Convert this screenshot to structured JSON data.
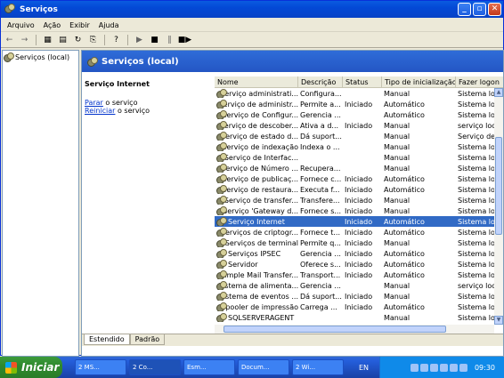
{
  "window": {
    "title": "Serviços"
  },
  "menu": [
    "Arquivo",
    "Ação",
    "Exibir",
    "Ajuda"
  ],
  "tree": {
    "root_label": "Serviços (local)"
  },
  "panel": {
    "header_title": "Serviços (local)",
    "selected_service": "Serviço Internet",
    "stop_link": "Parar",
    "stop_suffix": " o serviço",
    "restart_link": "Reiniciar",
    "restart_suffix": " o serviço"
  },
  "table": {
    "columns": [
      "Nome",
      "Descrição",
      "Status",
      "Tipo de inicialização",
      "Fazer logon"
    ],
    "rows": [
      [
        "Serviço administrati...",
        "Configura...",
        "",
        "Manual",
        "Sistema loca"
      ],
      [
        "Serviço de administr...",
        "Permite a...",
        "Iniciado",
        "Automático",
        "Sistema loca"
      ],
      [
        "Serviço de Configur...",
        "Gerencia ...",
        "",
        "Automático",
        "Sistema loca"
      ],
      [
        "Serviço de descober...",
        "Ativa a d...",
        "Iniciado",
        "Manual",
        "serviço loca"
      ],
      [
        "Serviço de estado d...",
        "Dá suport...",
        "",
        "Manual",
        "Serviço de r"
      ],
      [
        "Serviço de indexação",
        "Indexa o ...",
        "",
        "Manual",
        "Sistema loca"
      ],
      [
        "Serviço de Interfac...",
        "",
        "",
        "Manual",
        "Sistema loca"
      ],
      [
        "Serviço de Número ...",
        "Recupera...",
        "",
        "Manual",
        "Sistema loca"
      ],
      [
        "Serviço de publicaç...",
        "Fornece c...",
        "Iniciado",
        "Automático",
        "Sistema loca"
      ],
      [
        "Serviço de restaura...",
        "Executa f...",
        "Iniciado",
        "Automático",
        "Sistema loca"
      ],
      [
        "Serviço de transfer...",
        "Transfere...",
        "Iniciado",
        "Manual",
        "Sistema loca"
      ],
      [
        "Serviço 'Gateway d...",
        "Fornece s...",
        "Iniciado",
        "Manual",
        "Sistema loca"
      ],
      [
        "Serviço Internet",
        "",
        "Iniciado",
        "Automático",
        "Sistema loca"
      ],
      [
        "Serviços de criptogr...",
        "Fornece t...",
        "Iniciado",
        "Automático",
        "Sistema loca"
      ],
      [
        "Serviços de terminal",
        "Permite q...",
        "Iniciado",
        "Manual",
        "Sistema loca"
      ],
      [
        "Serviços IPSEC",
        "Gerencia ...",
        "Iniciado",
        "Automático",
        "Sistema loca"
      ],
      [
        "Servidor",
        "Oferece s...",
        "Iniciado",
        "Automático",
        "Sistema loca"
      ],
      [
        "Simple Mail Transfer...",
        "Transport...",
        "Iniciado",
        "Automático",
        "Sistema loca"
      ],
      [
        "Sistema de alimenta...",
        "Gerencia ...",
        "",
        "Manual",
        "serviço loca"
      ],
      [
        "Sistema de eventos ...",
        "Dá suport...",
        "Iniciado",
        "Manual",
        "Sistema loca"
      ],
      [
        "Spooler de impressão",
        "Carrega ...",
        "Iniciado",
        "Automático",
        "Sistema loca"
      ],
      [
        "SQLSERVERAGENT",
        "",
        "",
        "Manual",
        "Sistema loca"
      ]
    ],
    "selected_row": 12
  },
  "tabs": [
    "Estendido",
    "Padrão"
  ],
  "taskbar": {
    "start": "Iniciar",
    "tasks": [
      "2 MS...",
      "2 Co...",
      "Esm...",
      "Docum...",
      "2 Wi..."
    ],
    "language": "EN",
    "clock": "09:30"
  }
}
